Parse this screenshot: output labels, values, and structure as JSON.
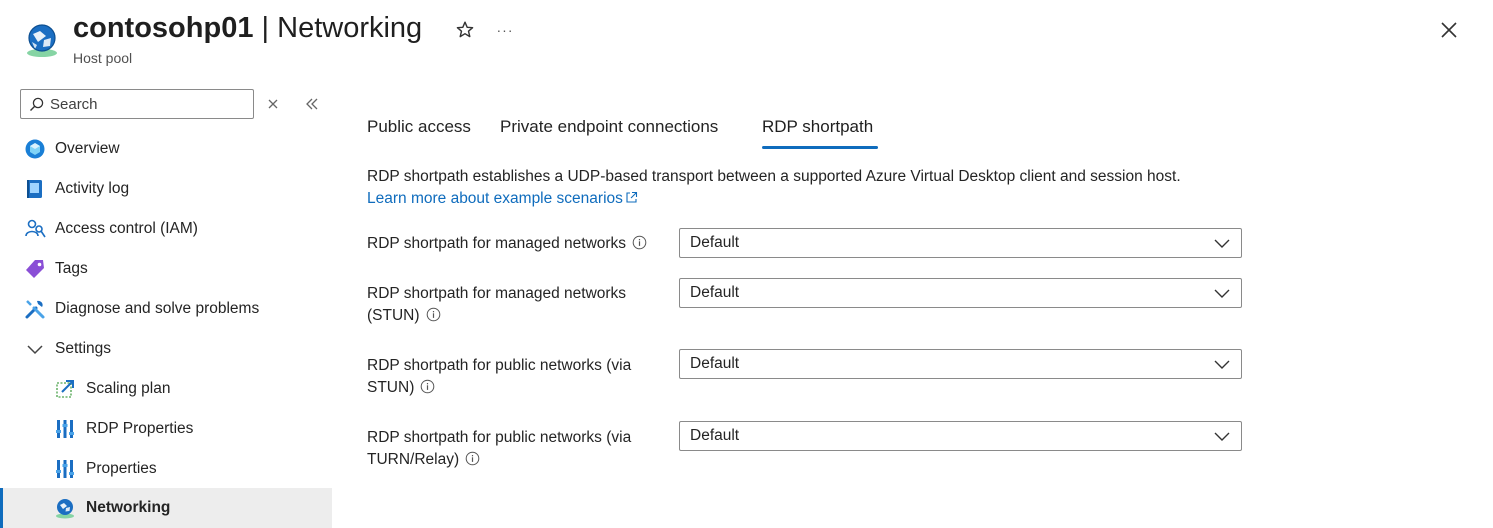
{
  "header": {
    "resource_name": "contosohp01",
    "separator": " | ",
    "page_name": "Networking",
    "subtitle": "Host pool",
    "more_label": "···"
  },
  "sidebar": {
    "search_placeholder": "Search",
    "items": [
      {
        "label": "Overview",
        "icon": "overview-icon"
      },
      {
        "label": "Activity log",
        "icon": "activity-log-icon"
      },
      {
        "label": "Access control (IAM)",
        "icon": "iam-icon"
      },
      {
        "label": "Tags",
        "icon": "tag-icon"
      },
      {
        "label": "Diagnose and solve problems",
        "icon": "wrench-icon"
      },
      {
        "label": "Settings",
        "icon": "chevron-down-icon"
      },
      {
        "label": "Scaling plan",
        "icon": "scaling-plan-icon"
      },
      {
        "label": "RDP Properties",
        "icon": "properties-icon"
      },
      {
        "label": "Properties",
        "icon": "properties-icon"
      },
      {
        "label": "Networking",
        "icon": "networking-icon",
        "active": true
      }
    ]
  },
  "tabs": [
    {
      "label": "Public access"
    },
    {
      "label": "Private endpoint connections"
    },
    {
      "label": "RDP shortpath",
      "selected": true
    }
  ],
  "content": {
    "description": "RDP shortpath establishes a UDP-based transport between a supported Azure Virtual Desktop client and session host.",
    "learn_more": "Learn more about example scenarios",
    "settings": [
      {
        "label": "RDP shortpath for managed networks",
        "value": "Default"
      },
      {
        "label": "RDP shortpath for managed networks (STUN)",
        "value": "Default"
      },
      {
        "label": "RDP shortpath for public networks (via STUN)",
        "value": "Default"
      },
      {
        "label": "RDP shortpath for public networks (via TURN/Relay)",
        "value": "Default"
      }
    ]
  },
  "colors": {
    "accent": "#0f6cbd",
    "active_bg": "#ededed"
  }
}
